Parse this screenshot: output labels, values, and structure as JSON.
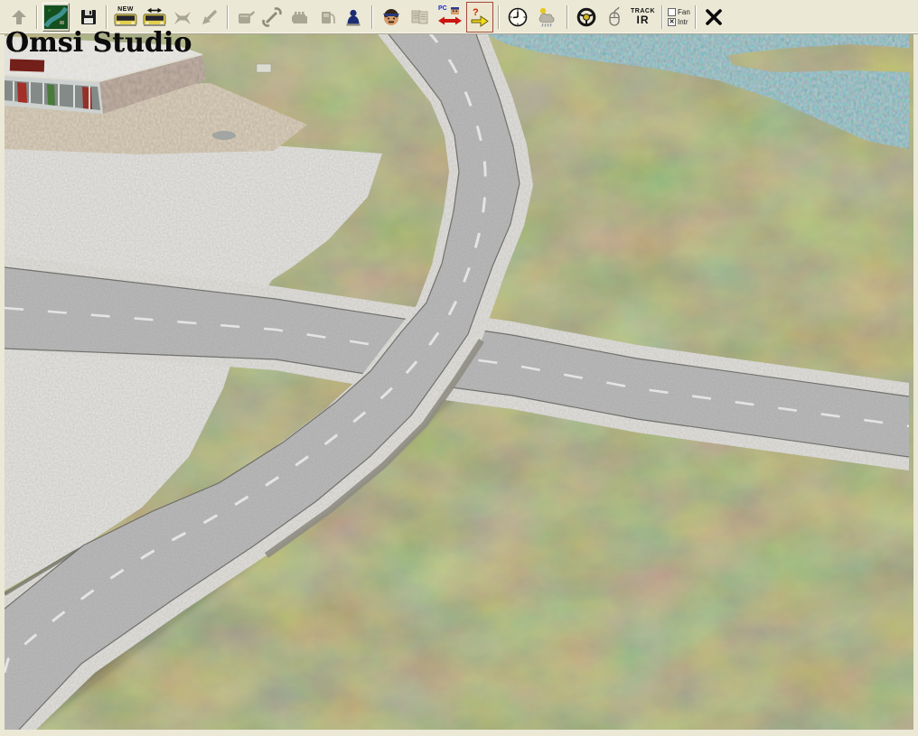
{
  "app": {
    "name": "Omsi Studio"
  },
  "toolbar": {
    "background": "#ebe8d6",
    "buttons": [
      {
        "name": "up-arrow",
        "enabled": false
      },
      {
        "name": "map-tile",
        "enabled": true
      },
      {
        "name": "save",
        "enabled": true
      },
      {
        "name": "new-bus",
        "enabled": true,
        "label": "NEW"
      },
      {
        "name": "change-bus",
        "enabled": true
      },
      {
        "name": "remove-bus",
        "enabled": false
      },
      {
        "name": "exit-bus",
        "enabled": false
      },
      {
        "name": "refuel",
        "enabled": false
      },
      {
        "name": "repair-wrench",
        "enabled": false
      },
      {
        "name": "engine",
        "enabled": false
      },
      {
        "name": "fuel-pump",
        "enabled": false
      },
      {
        "name": "ai-police",
        "enabled": true
      },
      {
        "name": "driver",
        "enabled": true
      },
      {
        "name": "timetable",
        "enabled": false
      },
      {
        "name": "pc-driver-swap",
        "enabled": true,
        "label": "PC"
      },
      {
        "name": "question-arrow",
        "enabled": true,
        "active": true
      },
      {
        "name": "clock",
        "enabled": true
      },
      {
        "name": "weather",
        "enabled": true
      },
      {
        "name": "steering-wheel",
        "enabled": true
      },
      {
        "name": "mouse",
        "enabled": true
      },
      {
        "name": "trackir",
        "enabled": true,
        "label_top": "TRACK",
        "label_bottom": "IR"
      },
      {
        "name": "close",
        "enabled": true
      }
    ],
    "checkboxes": [
      {
        "label": "Fan",
        "checked": false
      },
      {
        "label": "Intr",
        "checked": true
      }
    ]
  },
  "viewport": {
    "overlay_title": "Omsi Studio",
    "scene": {
      "colors": {
        "grass": "#6e7052",
        "water": "#4f7f80",
        "plaza": "#b2b0aa",
        "apron": "#9b8b76",
        "asphalt": "#727272",
        "sidewalk": "#aca89d",
        "roof": "#c5c3bc",
        "brick": "#6e5b51",
        "sign": "#731f1a",
        "lane_marking": "#ececec"
      }
    }
  }
}
